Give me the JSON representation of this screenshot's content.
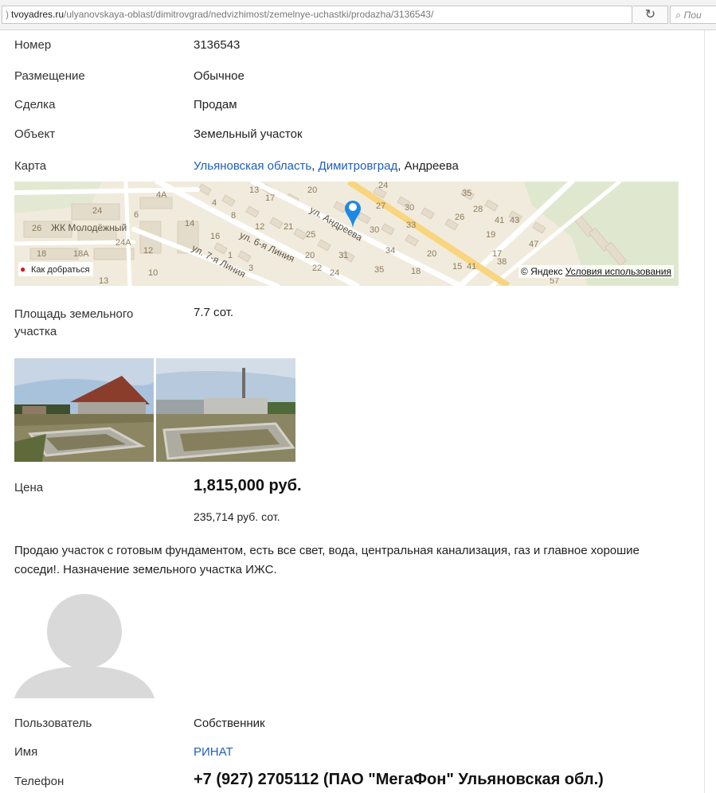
{
  "browser": {
    "url_domain": "tvoyadres.ru",
    "url_path": "/ulyanovskaya-oblast/dimitrovgrad/nedvizhimost/zemelnye-uchastki/prodazha/3136543/",
    "reload_icon": "reload-icon",
    "search_placeholder": "Пои"
  },
  "listing": {
    "number_label": "Номер",
    "number_value": "3136543",
    "placement_label": "Размещение",
    "placement_value": "Обычное",
    "deal_label": "Сделка",
    "deal_value": "Продам",
    "object_label": "Объект",
    "object_value": "Земельный участок",
    "map_label": "Карта",
    "map_region": "Ульяновская область",
    "map_sep1": ", ",
    "map_city": "Димитровград",
    "map_sep2": ", ",
    "map_street": "Андреева",
    "area_label": "Площадь земельного участка",
    "area_value": "7.7 сот.",
    "price_label": "Цена",
    "price_value": "1,815,000 руб.",
    "price_per_unit": "235,714 руб. сот.",
    "description": "Продаю участок с готовым фундаментом, есть все свет, вода, центральная канализация, газ и главное хорошие соседи!. Назначение земельного участка ИЖС."
  },
  "map": {
    "route_label": "Как добраться",
    "copyright": "© Яндекс",
    "terms_label": "Условия использования",
    "labels": {
      "street_andreeva": "ул. Андреева",
      "street_6": "ул. 6-я Линия",
      "street_7": "ул. 7-я Линия",
      "district": "ЖК Молодёжный",
      "n1": "4А",
      "n2": "13",
      "n3": "17",
      "n4": "20",
      "n5": "24",
      "n6": "27",
      "n7": "30",
      "n8": "33",
      "n9": "35",
      "n10": "26",
      "n11": "28",
      "n12": "41",
      "n13": "43",
      "n14": "19",
      "n15": "47",
      "n16": "24",
      "n17": "26",
      "n18": "6",
      "n19": "14",
      "n20": "16",
      "n21": "21",
      "n22": "25",
      "n23": "30",
      "n24": "34",
      "n25": "18А",
      "n26": "24А",
      "n27": "12",
      "n28": "10",
      "n29": "18",
      "n30": "20",
      "n31": "31",
      "n32": "35",
      "n33": "15",
      "n34": "41",
      "n35": "38",
      "n36": "57",
      "n37": "22",
      "n38": "24",
      "n39": "18",
      "n40": "1",
      "n41": "3",
      "n42": "4",
      "n43": "8",
      "n44": "12",
      "n45": "13",
      "n46": "20",
      "n47": "17"
    }
  },
  "seller": {
    "user_label": "Пользователь",
    "user_value": "Собственник",
    "name_label": "Имя",
    "name_value": "РИНАТ",
    "phone_label": "Телефон",
    "phone_value": "+7 (927) 2705112 (ПАО \"МегаФон\" Ульяновская обл.)"
  },
  "colors": {
    "link": "#1f5fb8",
    "map_bg": "#f1ebdd",
    "map_pin": "#1e88e5",
    "avatar": "#d9d9d9"
  }
}
